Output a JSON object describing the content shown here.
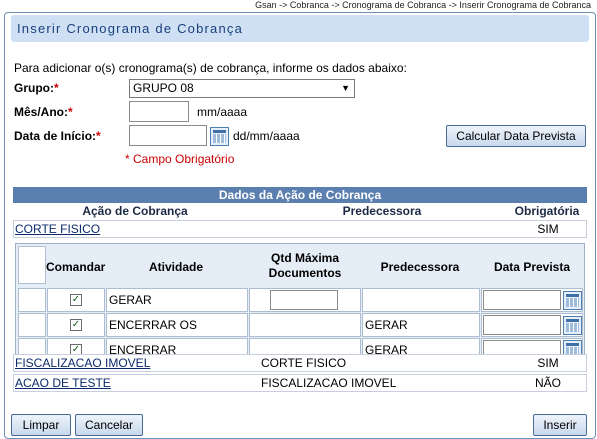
{
  "breadcrumb": "Gsan -> Cobranca -> Cronograma de Cobranca -> Inserir Cronograma de Cobranca",
  "title": "Inserir Cronograma de Cobrança",
  "intro": "Para adicionar o(s) cronograma(s) de cobrança, informe os dados abaixo:",
  "form": {
    "grupo_label": "Grupo:",
    "grupo_value": "GRUPO 08",
    "mes_ano_label": "Mês/Ano:",
    "mes_ano_value": "",
    "mes_ano_hint": "mm/aaaa",
    "data_inicio_label": "Data de Início:",
    "data_inicio_value": "",
    "data_inicio_hint": "dd/mm/aaaa",
    "required_mark": "*",
    "required_note": "* Campo Obrigatório",
    "calc_button": "Calcular Data Prevista"
  },
  "section_title": "Dados da Ação de Cobrança",
  "acao_headers": {
    "acao": "Ação de Cobrança",
    "predecessora": "Predecessora",
    "obrigatoria": "Obrigatória"
  },
  "acoes": [
    {
      "acao": "CORTE FISICO",
      "predecessora": "",
      "obrigatoria": "SIM"
    },
    {
      "acao": "FISCALIZACAO IMOVEL",
      "predecessora": "CORTE FISICO",
      "obrigatoria": "SIM"
    },
    {
      "acao": "ACAO DE TESTE",
      "predecessora": "FISCALIZACAO IMOVEL",
      "obrigatoria": "NÃO"
    }
  ],
  "atividade_headers": {
    "comandar": "Comandar",
    "atividade": "Atividade",
    "qtd_line1": "Qtd Máxima",
    "qtd_line2": "Documentos",
    "predecessora": "Predecessora",
    "data_prevista": "Data Prevista"
  },
  "atividades": [
    {
      "checked": "✓",
      "atividade": "GERAR",
      "predecessora": "",
      "data_prevista": ""
    },
    {
      "checked": "✓",
      "atividade": "ENCERRAR OS",
      "predecessora": "GERAR",
      "data_prevista": ""
    },
    {
      "checked": "✓",
      "atividade": "ENCERRAR",
      "predecessora": "GERAR",
      "data_prevista": ""
    }
  ],
  "buttons": {
    "limpar": "Limpar",
    "cancelar": "Cancelar",
    "inserir": "Inserir"
  }
}
